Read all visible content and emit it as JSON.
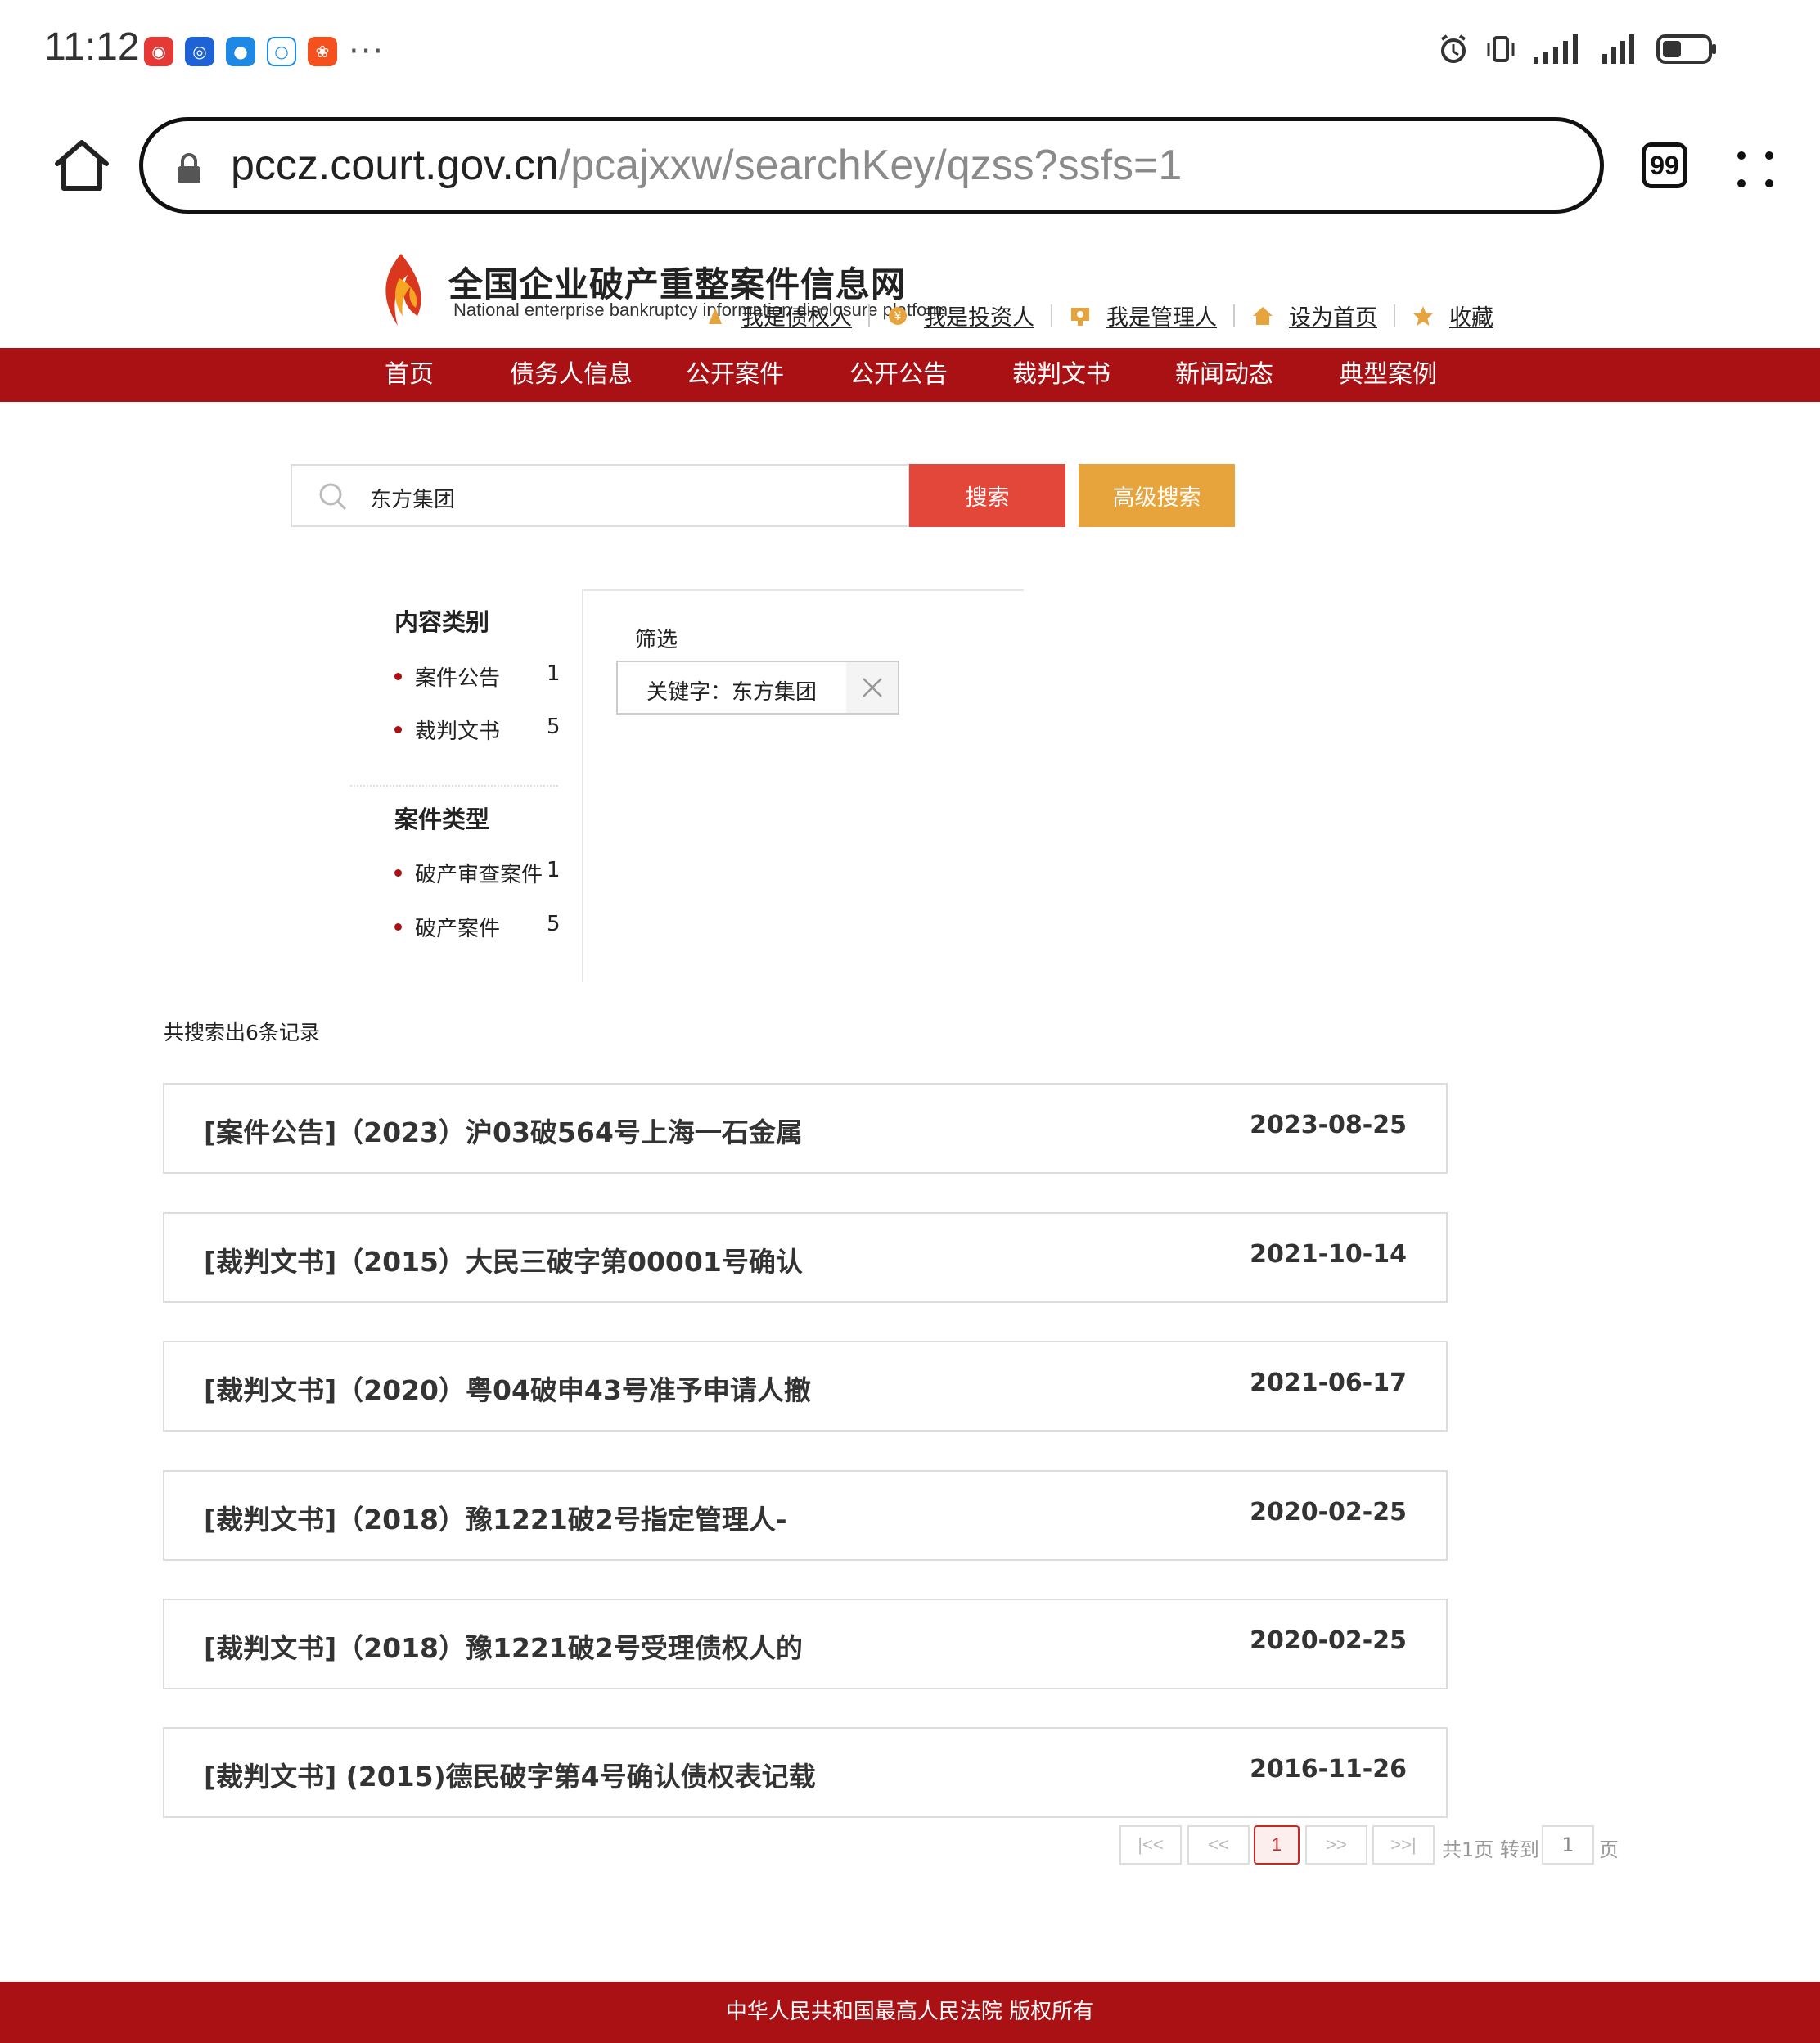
{
  "status_bar": {
    "time": "11:12",
    "more": "···",
    "app_icons": [
      "app-red-icon",
      "app-blue-icon",
      "app-message-icon",
      "app-chat-icon",
      "app-orange-icon"
    ],
    "right_icons": [
      "alarm-icon",
      "vibrate-icon",
      "signal-icon",
      "signal-icon",
      "battery-icon"
    ]
  },
  "browser": {
    "url_host": "pccz.court.gov.cn",
    "url_path": "/pcajxxw/searchKey/qzss?ssfs=1",
    "tab_count": "99"
  },
  "header": {
    "title": "全国企业破产重整案件信息网",
    "subtitle": "National enterprise bankruptcy information disclosure platform",
    "links": [
      {
        "label": "我是债权人",
        "icon": "creditor-icon"
      },
      {
        "label": "我是投资人",
        "icon": "investor-icon"
      },
      {
        "label": "我是管理人",
        "icon": "manager-icon"
      },
      {
        "label": "设为首页",
        "icon": "home-icon"
      },
      {
        "label": "收藏",
        "icon": "star-icon"
      }
    ]
  },
  "nav": [
    "首页",
    "债务人信息",
    "公开案件",
    "公开公告",
    "裁判文书",
    "新闻动态",
    "典型案例"
  ],
  "search": {
    "value": "东方集团",
    "search_label": "搜索",
    "advanced_label": "高级搜索"
  },
  "facets": {
    "content_title": "内容类别",
    "content_items": [
      {
        "label": "案件公告",
        "count": "1"
      },
      {
        "label": "裁判文书",
        "count": "5"
      }
    ],
    "type_title": "案件类型",
    "type_items": [
      {
        "label": "破产审查案件",
        "count": "1"
      },
      {
        "label": "破产案件",
        "count": "5"
      }
    ]
  },
  "filter": {
    "label": "筛选",
    "chip": "关键字：东方集团"
  },
  "results": {
    "summary": "共搜索出6条记录",
    "items": [
      {
        "title": "[案件公告]（2023）沪03破564号上海一石金属",
        "date": "2023-08-25"
      },
      {
        "title": "[裁判文书]（2015）大民三破字第00001号确认",
        "date": "2021-10-14"
      },
      {
        "title": "[裁判文书]（2020）粤04破申43号准予申请人撤",
        "date": "2021-06-17"
      },
      {
        "title": "[裁判文书]（2018）豫1221破2号指定管理人-",
        "date": "2020-02-25"
      },
      {
        "title": "[裁判文书]（2018）豫1221破2号受理债权人的",
        "date": "2020-02-25"
      },
      {
        "title": "[裁判文书] (2015)德民破字第4号确认债权表记载",
        "date": "2016-11-26"
      }
    ]
  },
  "pagination": {
    "first": "|<<",
    "prev": "<<",
    "current": "1",
    "next": ">>",
    "last": ">>|",
    "total": "共1页 转到",
    "goto_value": "1",
    "unit": "页"
  },
  "footer": {
    "text": "中华人民共和国最高人民法院 版权所有"
  },
  "colors": {
    "brand_red": "#a91114",
    "search_button": "#e3473a",
    "advanced_button": "#e7a43c"
  }
}
